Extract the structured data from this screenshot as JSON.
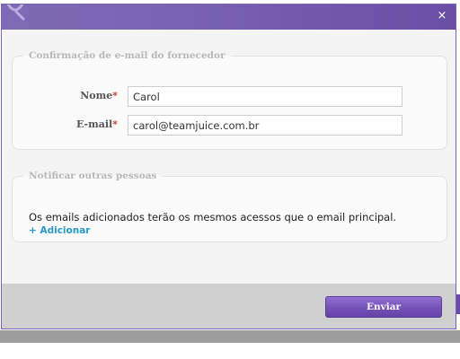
{
  "dialog": {
    "close_glyph": "×",
    "icons": {
      "logo": "app-logo-icon",
      "close": "close-icon"
    }
  },
  "supplier_section": {
    "legend": "Confirmação de e-mail do fornecedor",
    "name_label": "Nome",
    "email_label": "E-mail",
    "required_mark": "*",
    "name_value": "Carol",
    "email_value": "carol@teamjuice.com.br"
  },
  "notify_section": {
    "legend": "Notificar outras pessoas",
    "description": "Os emails adicionados terão os mesmos acessos que o email principal.",
    "add_link": "+ Adicionar"
  },
  "footer": {
    "send_label": "Enviar"
  },
  "colors": {
    "title_bar": "#7a62b2",
    "primary_button": "#7452b8",
    "link": "#2a9bc8",
    "required": "#c0392b"
  }
}
